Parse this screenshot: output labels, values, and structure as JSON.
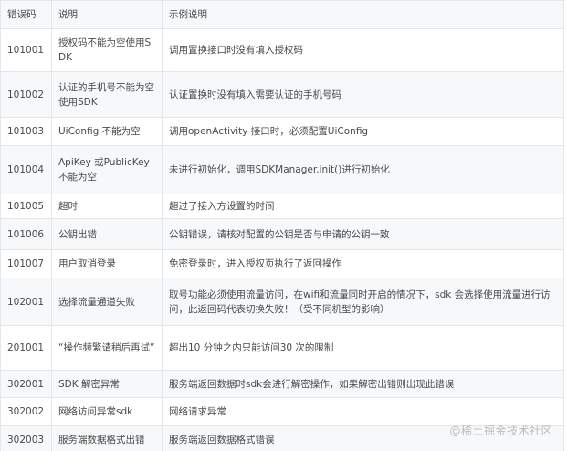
{
  "table": {
    "headers": [
      "错误码",
      "说明",
      "示例说明"
    ],
    "rows": [
      {
        "code": "101001",
        "desc": "授权码不能为空使用SDK",
        "example": "调用置换接口时没有填入授权码"
      },
      {
        "code": "101002",
        "desc": "认证的手机号不能为空使用SDK",
        "example": "认证置换时没有填入需要认证的手机号码"
      },
      {
        "code": "101003",
        "desc": "UiConfig 不能为空",
        "example": "调用openActivity 接口时，必须配置UiConfig"
      },
      {
        "code": "101004",
        "desc": "ApiKey 或PublicKey不能为空",
        "example": "未进行初始化，调用SDKManager.init()进行初始化"
      },
      {
        "code": "101005",
        "desc": "超时",
        "example": "超过了接入方设置的时间"
      },
      {
        "code": "101006",
        "desc": "公钥出错",
        "example": "公钥错误，请核对配置的公钥是否与申请的公钥一致"
      },
      {
        "code": "101007",
        "desc": "用户取消登录",
        "example": "免密登录时，进入授权页执行了返回操作"
      },
      {
        "code": "102001",
        "desc": "选择流量通道失败",
        "example": "取号功能必须使用流量访问，在wifi和流量同时开启的情况下，sdk 会选择使用流量进行访问，此返回码代表切换失败！（受不同机型的影响）"
      },
      {
        "code": "201001",
        "desc": "“操作频繁请稍后再试”",
        "example": "超出10 分钟之内只能访问30 次的限制"
      },
      {
        "code": "302001",
        "desc": "SDK 解密异常",
        "example": "服务端返回数据时sdk会进行解密操作，如果解密出错则出现此错误"
      },
      {
        "code": "302002",
        "desc": "网络访问异常sdk",
        "example": "网络请求异常"
      },
      {
        "code": "302003",
        "desc": "服务端数据格式出错",
        "example": "服务端返回数据格式错误"
      }
    ]
  },
  "watermark": "@稀土掘金技术社区"
}
